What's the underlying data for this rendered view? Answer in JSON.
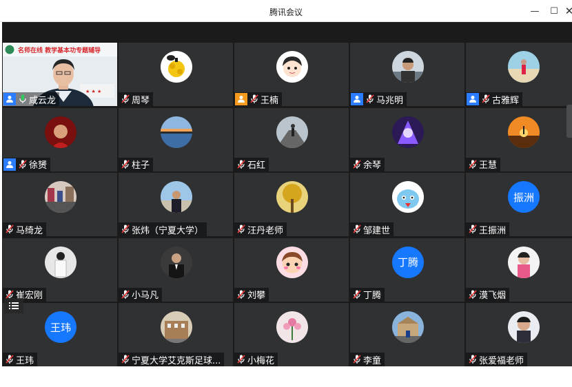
{
  "window": {
    "title": "腾讯会议",
    "minimize": "—",
    "maximize": "☐",
    "close": "✕"
  },
  "featured": {
    "banner": "名师在线 教学基本功专题辅导",
    "name": "咸云龙"
  },
  "participants": [
    {
      "name": "周琴",
      "avatar": "fruit"
    },
    {
      "name": "王楠",
      "avatar": "cartoon-girl",
      "badge": "orange"
    },
    {
      "name": "马兆明",
      "avatar": "photo-man",
      "badge": "blue"
    },
    {
      "name": "古雅辉",
      "avatar": "beach-person",
      "badge": "blue"
    },
    {
      "name": "徐赟",
      "avatar": "red-portrait",
      "badge": "blue"
    },
    {
      "name": "柱子",
      "avatar": "lake-sunset"
    },
    {
      "name": "石红",
      "avatar": "road-runner"
    },
    {
      "name": "余琴",
      "avatar": "purple-art"
    },
    {
      "name": "王慧",
      "avatar": "orange-sunset"
    },
    {
      "name": "马绮龙",
      "avatar": "city-crowd"
    },
    {
      "name": "张炜（宁夏大学）",
      "avatar": "person-outdoor"
    },
    {
      "name": "汪丹老师",
      "avatar": "autumn-tree"
    },
    {
      "name": "邹建世",
      "avatar": "blue-creature"
    },
    {
      "name": "王振洲",
      "avatar": "text",
      "initials": "振洲"
    },
    {
      "name": "崔宏刚",
      "avatar": "white-shirt"
    },
    {
      "name": "小马凡",
      "avatar": "suit-man"
    },
    {
      "name": "刘攀",
      "avatar": "cartoon-boy"
    },
    {
      "name": "丁腾",
      "avatar": "text",
      "initials": "丁腾"
    },
    {
      "name": "漠飞烟",
      "avatar": "child-photo"
    },
    {
      "name": "王玮",
      "avatar": "text",
      "initials": "王玮"
    },
    {
      "name": "宁夏大学艾克斯足球...",
      "avatar": "building"
    },
    {
      "name": "小梅花",
      "avatar": "pink-flower"
    },
    {
      "name": "李童",
      "avatar": "landmark"
    },
    {
      "name": "张爱福老师",
      "avatar": "boy-portrait"
    }
  ],
  "colors": {
    "tile_bg": "#2f3133",
    "gallery_bg": "#1b1b1b",
    "accent_blue": "#1677ff",
    "host_orange": "#f39a1f",
    "mic_muted_red": "#e23b3b"
  }
}
